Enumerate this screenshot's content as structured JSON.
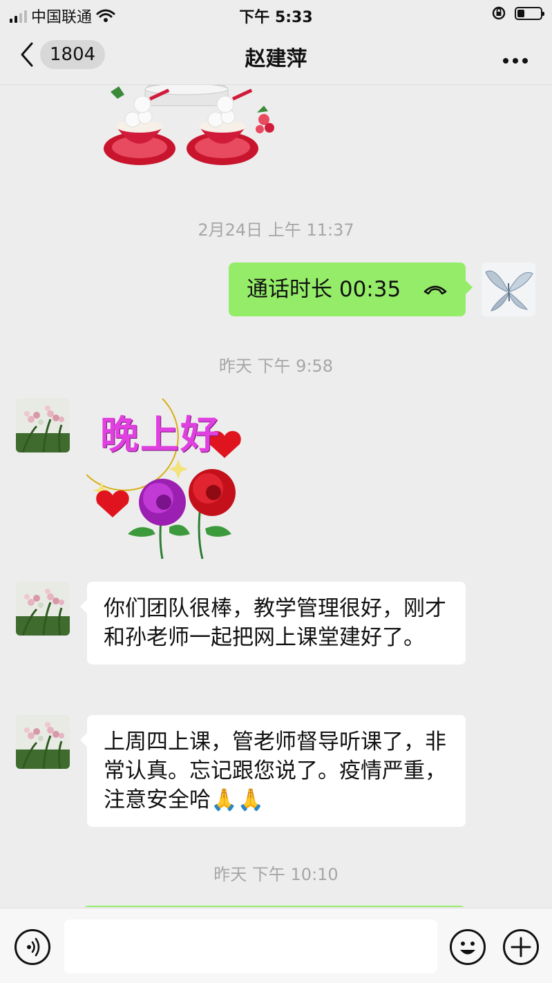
{
  "status_bar": {
    "carrier": "中国联通",
    "time": "下午 5:33"
  },
  "nav": {
    "unread_count": "1804",
    "title": "赵建萍"
  },
  "timestamps": [
    "2月24日 上午 11:37",
    "昨天 下午 9:58",
    "昨天 下午 10:10"
  ],
  "messages": {
    "call": {
      "text": "通话时长 00:35"
    },
    "sticker_greeting": {
      "text": "晚上好"
    },
    "msg1": {
      "text": "你们团队很棒，教学管理很好，刚才和孙老师一起把网上课堂建好了。"
    },
    "msg2": {
      "text": "上周四上课，管老师督导听课了，非常认真。忘记跟您说了。疫情严重，注意安全哈🙏🙏"
    }
  },
  "input": {
    "placeholder": ""
  },
  "icons": {
    "back": "chevron-left-icon",
    "more": "more-icon",
    "call": "phone-hangup-icon",
    "voice": "voice-icon",
    "emoji": "emoji-icon",
    "plus": "plus-icon"
  },
  "colors": {
    "background": "#ededed",
    "sent_bubble": "#95ec69",
    "received_bubble": "#ffffff",
    "title_pink": "#e040e0"
  }
}
